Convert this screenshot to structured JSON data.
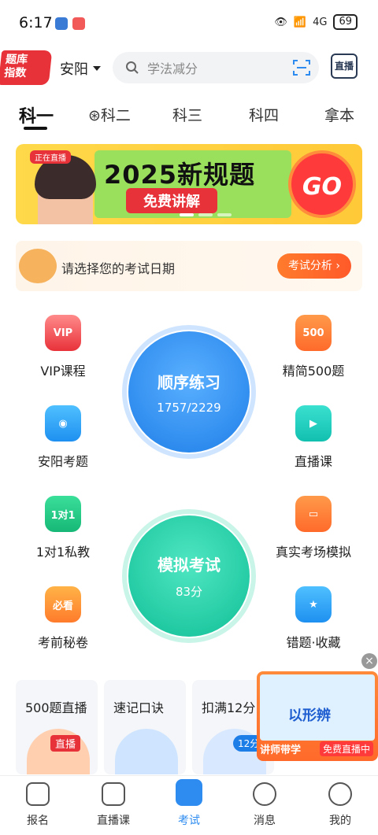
{
  "status": {
    "time": "6:17",
    "battery": "69",
    "network": "4G"
  },
  "header": {
    "logo_line1": "题库",
    "logo_line2": "指数",
    "city": "安阳",
    "search_placeholder": "学法减分",
    "live_label": "直播"
  },
  "tabs": [
    "科一",
    "科二",
    "科三",
    "科四",
    "拿本"
  ],
  "banner": {
    "live_tag": "正在直播",
    "title": "2025新规题",
    "subtitle": "免费讲解",
    "go": "GO"
  },
  "exam_date": {
    "text": "请选择您的考试日期",
    "button": "考试分析 ›"
  },
  "grid": {
    "left": [
      {
        "label": "VIP课程",
        "icon": "vip-icon",
        "badge": "VIP"
      },
      {
        "label": "安阳考题",
        "icon": "location-icon",
        "badge": ""
      },
      {
        "label": "1对1私教",
        "icon": "tutor-icon",
        "badge": "1对1"
      },
      {
        "label": "考前秘卷",
        "icon": "exam-paper-icon",
        "badge": "必看"
      }
    ],
    "right": [
      {
        "label": "精简500题",
        "icon": "500-icon",
        "badge": "500"
      },
      {
        "label": "直播课",
        "icon": "video-icon",
        "badge": ""
      },
      {
        "label": "真实考场模拟",
        "icon": "monitor-icon",
        "badge": ""
      },
      {
        "label": "错题·收藏",
        "icon": "bookmark-icon",
        "badge": ""
      }
    ]
  },
  "practice": {
    "title": "顺序练习",
    "progress": "1757/2229"
  },
  "mock": {
    "title": "模拟考试",
    "score": "83分"
  },
  "cards": [
    {
      "title": "500题直播",
      "badge": "直播"
    },
    {
      "title": "速记口诀"
    },
    {
      "title": "扣满12分",
      "badge": "12分"
    }
  ],
  "float_video": {
    "teacher_label": "讲师带学",
    "live_label": "免费直播中",
    "screen_text": "以形辨"
  },
  "nav": [
    {
      "label": "报名",
      "icon": "signup-icon",
      "active": false
    },
    {
      "label": "直播课",
      "icon": "tv-icon",
      "active": false
    },
    {
      "label": "考试",
      "icon": "exam-icon",
      "active": true
    },
    {
      "label": "消息",
      "icon": "message-icon",
      "active": false
    },
    {
      "label": "我的",
      "icon": "profile-icon",
      "active": false
    }
  ],
  "colors": {
    "accent": "#2e8cf0",
    "practice_blue": "#2a8cf0",
    "mock_green": "#1fc7a5",
    "brand_red": "#e8323a"
  }
}
